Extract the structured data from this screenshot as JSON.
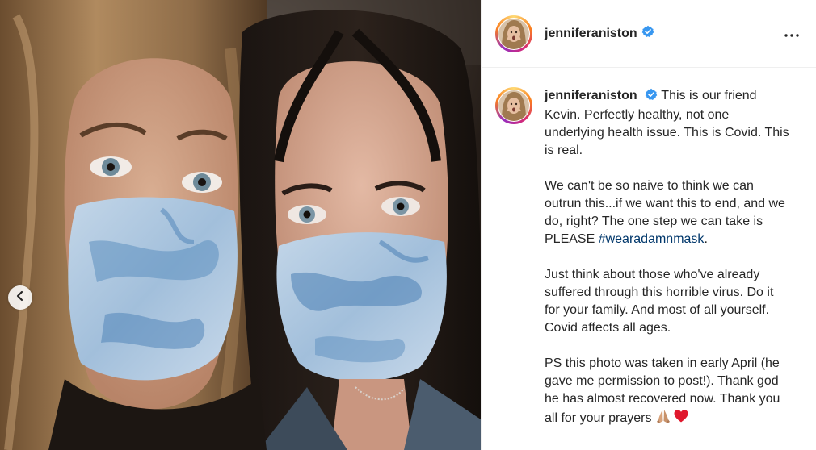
{
  "post": {
    "username": "jenniferaniston",
    "verified": true,
    "more_icon": "more-horizontal-icon",
    "carousel": {
      "prev_icon": "chevron-left-icon"
    },
    "image": {
      "subject": "two-women-wearing-blue-tie-dye-masks",
      "colors": {
        "background": "#241c17",
        "mask": "#a9c4dc",
        "mask_dye": "#4a7fb5",
        "hair_blonde": "#8a6a45",
        "hair_dark": "#221a16",
        "skin": "#c89a80"
      }
    },
    "caption": {
      "intro": "This is our friend Kevin. Perfectly healthy, not one underlying health issue. This is Covid. This is real.",
      "para2_text": "We can't be so naive to think we can outrun this...if we want this to end, and we do, right? The one step we can take is PLEASE ",
      "hashtag": "#wearadamnmask",
      "para2_end": ".",
      "para3": "Just think about those who've already suffered through this horrible virus. Do it for your family. And most of all yourself. Covid affects all ages.",
      "para4": "PS this photo was taken in early April (he gave me permission to post!). Thank god he has almost recovered now. Thank you all for your prayers",
      "emojis": [
        "folded-hands-icon",
        "red-heart-icon"
      ]
    },
    "theme": {
      "text": "#262626",
      "hashtag": "#00376b",
      "verified_blue": "#3897f0",
      "border": "#efefef"
    }
  }
}
